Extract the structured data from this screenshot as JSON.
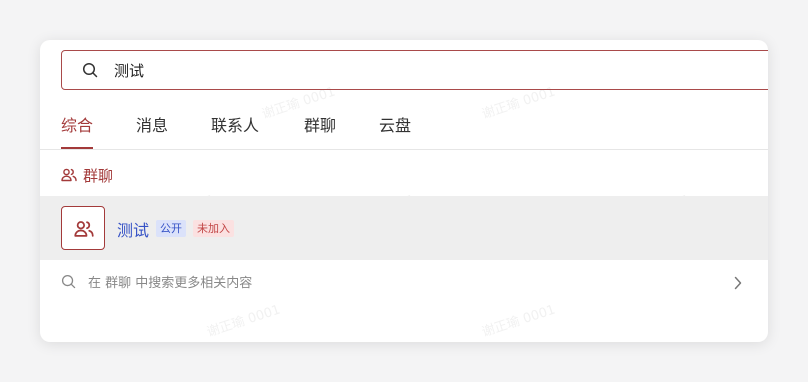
{
  "search": {
    "value": "测试",
    "icon": "search-icon"
  },
  "tabs": [
    {
      "label": "综合",
      "active": true
    },
    {
      "label": "消息",
      "active": false
    },
    {
      "label": "联系人",
      "active": false
    },
    {
      "label": "群聊",
      "active": false
    },
    {
      "label": "云盘",
      "active": false
    }
  ],
  "section": {
    "title": "群聊",
    "icon": "group-icon"
  },
  "result": {
    "name": "测试",
    "badge_public": "公开",
    "badge_status": "未加入",
    "avatar_icon": "group-icon"
  },
  "more": {
    "text": "在 群聊 中搜索更多相关内容",
    "icon": "search-icon",
    "chevron": "chevron-right-icon"
  },
  "watermark": "谢正瑜 0001",
  "colors": {
    "accent": "#a33a3a",
    "link": "#3552c6",
    "row_bg": "#eeeeee"
  }
}
